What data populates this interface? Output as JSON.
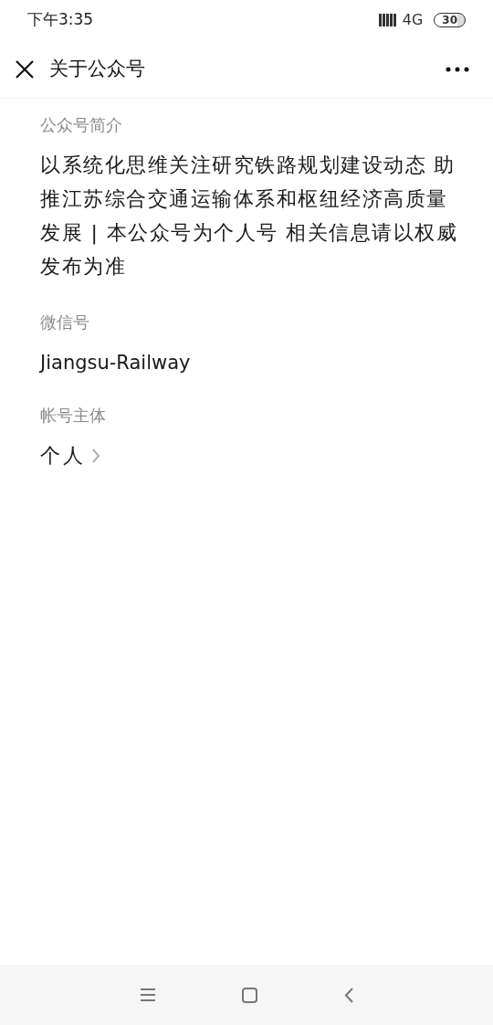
{
  "status_bar": {
    "time": "下午3:35",
    "network": "4G",
    "battery": "30"
  },
  "header": {
    "title": "关于公众号"
  },
  "sections": [
    {
      "label": "公众号简介",
      "value": "以系统化思维关注研究铁路规划建设动态 助推江苏综合交通运输体系和枢纽经济高质量发展 | 本公众号为个人号 相关信息请以权威发布为准",
      "kind": "paragraph"
    },
    {
      "label": "微信号",
      "value": "Jiangsu-Railway",
      "kind": "text"
    },
    {
      "label": "帐号主体",
      "value": "个人",
      "kind": "link"
    }
  ]
}
